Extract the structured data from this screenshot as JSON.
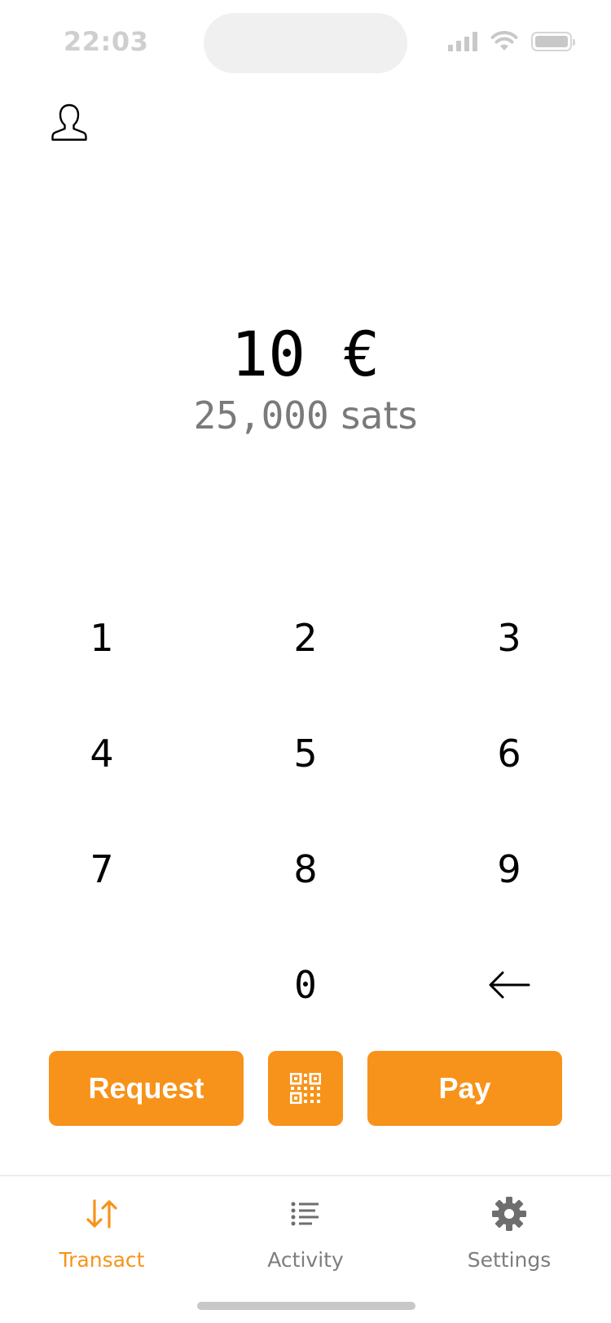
{
  "status_bar": {
    "time": "22:03"
  },
  "amount": {
    "primary": "10 €",
    "secondary_value": "25,000",
    "secondary_unit": "sats"
  },
  "keypad": {
    "keys": [
      "1",
      "2",
      "3",
      "4",
      "5",
      "6",
      "7",
      "8",
      "9",
      "",
      "0",
      "backspace"
    ],
    "backspace_icon": "arrow-left-icon"
  },
  "actions": {
    "request_label": "Request",
    "scan_icon": "qr-code-icon",
    "pay_label": "Pay"
  },
  "nav": {
    "items": [
      {
        "label": "Transact",
        "icon": "arrows-up-down-icon",
        "active": true
      },
      {
        "label": "Activity",
        "icon": "list-icon",
        "active": false
      },
      {
        "label": "Settings",
        "icon": "gear-icon",
        "active": false
      }
    ]
  },
  "colors": {
    "accent": "#f7931a",
    "muted_text": "#7d7d7d",
    "secondary_amount": "#7a7a7a"
  }
}
